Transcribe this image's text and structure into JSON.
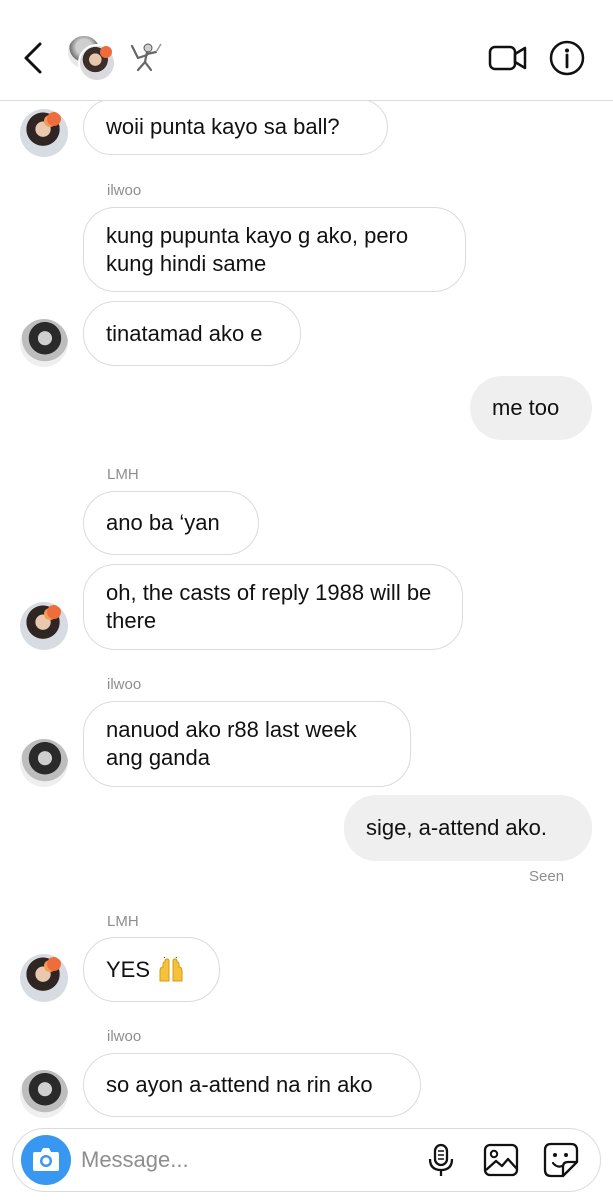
{
  "header": {
    "back_icon": "chevron-left-icon",
    "group_avatar_icon": "group-avatar-icon",
    "group_name_icon": "fencer-emoji-icon",
    "video_icon": "video-camera-icon",
    "info_icon": "info-icon"
  },
  "messages": [
    {
      "side": "in",
      "sender_label": "",
      "text": "woii punta kayo sa ball?",
      "avatar": "lmh"
    },
    {
      "side": "in",
      "sender_label": "ilwoo",
      "text": "kung pupunta kayo g ako, pero kung hindi same",
      "avatar": ""
    },
    {
      "side": "in",
      "sender_label": "",
      "text": "tinatamad ako e",
      "avatar": "ilwoo"
    },
    {
      "side": "out",
      "text": "me too"
    },
    {
      "side": "in",
      "sender_label": "LMH",
      "text": "ano ba ‘yan",
      "avatar": ""
    },
    {
      "side": "in",
      "sender_label": "",
      "text": "oh, the casts of reply 1988 will be there",
      "avatar": "lmh"
    },
    {
      "side": "in",
      "sender_label": "ilwoo",
      "text": "nanuod ako r88 last week ang ganda",
      "avatar": "ilwoo"
    },
    {
      "side": "out",
      "text": "sige, a-attend ako."
    },
    {
      "side": "in",
      "sender_label": "LMH",
      "text": "YES",
      "emoji": "raising-hands-emoji",
      "avatar": "lmh"
    },
    {
      "side": "in",
      "sender_label": "ilwoo",
      "text": "so ayon a-attend na rin ako",
      "avatar": "ilwoo"
    }
  ],
  "status": {
    "seen": "Seen"
  },
  "composer": {
    "camera_icon": "camera-icon",
    "placeholder": "Message...",
    "mic_icon": "microphone-icon",
    "gallery_icon": "gallery-icon",
    "sticker_icon": "sticker-icon"
  },
  "colors": {
    "accent": "#3897f0",
    "outgoing_bubble": "#efefef",
    "border": "#dbdbdb",
    "meta_text": "#8e8e8e"
  }
}
